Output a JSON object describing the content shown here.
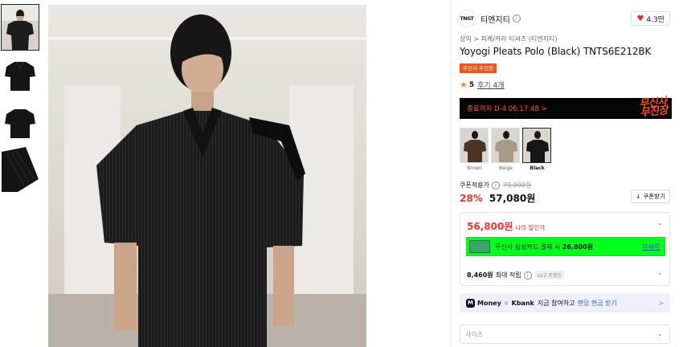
{
  "thumbnails": [
    {
      "label": "model-front"
    },
    {
      "label": "flat-front"
    },
    {
      "label": "flat-back"
    },
    {
      "label": "fabric-detail"
    }
  ],
  "brand": {
    "logo_text": "TNGT",
    "name": "티엔지티",
    "info_icon": "i",
    "likes": "4.3만"
  },
  "breadcrumb": "상의 > 피케/카라 티셔츠 (티엔지티)",
  "product": {
    "title": "Yoyogi Pleats Polo (Black) TNTS6E212BK",
    "badge": "무신사 무진장",
    "rating": "5",
    "reviews": "후기 4개"
  },
  "timer": {
    "text": "종료까지 D-4 06:17:48 >",
    "logo_line1": "무신사",
    "logo_line2": "무진장"
  },
  "colors": [
    {
      "name": "Brown",
      "selected": false
    },
    {
      "name": "Beige",
      "selected": false
    },
    {
      "name": "Black",
      "selected": true
    }
  ],
  "pricing": {
    "coupon_label": "쿠폰적용가",
    "original_price": "79,000원",
    "discount": "28%",
    "price": "57,080원",
    "coupon_button": "쿠폰받기"
  },
  "benefits": {
    "my_price": "56,800원",
    "my_price_label": "나의 할인가",
    "card_text_prefix": "무신사 삼성카드 결제 시",
    "card_price": "26,800원",
    "card_detail": "자세히",
    "accrual_amount": "8,460원",
    "accrual_label": "최대 적립",
    "level_tag": "LV.2 프렌즈"
  },
  "promo": {
    "icon": "M",
    "money": "Money",
    "x": "×",
    "kbank": "Kbank",
    "msg": "지금 참여하고",
    "link": "랜덤 현금 받기",
    "arrow": ">"
  },
  "size_select": {
    "placeholder": "사이즈",
    "chevron": "⌄"
  },
  "colors_accent": {
    "discount_red": "#f0352b",
    "badge_orange": "#f8501e",
    "card_green": "#00ff1a",
    "link_blue": "#2a52d1"
  }
}
